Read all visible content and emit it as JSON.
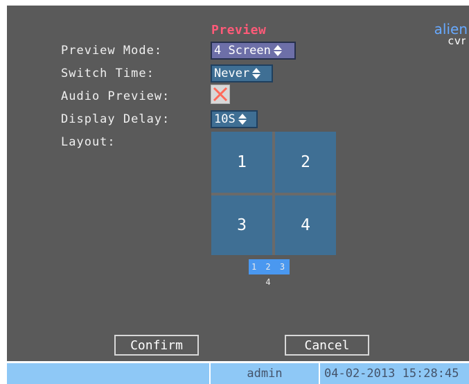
{
  "page": {
    "title": "Preview"
  },
  "logo": {
    "line1": "alien",
    "line2": "cvr"
  },
  "settings": {
    "preview_mode": {
      "label": "Preview Mode:",
      "value": "4 Screen"
    },
    "switch_time": {
      "label": "Switch Time:",
      "value": "Never"
    },
    "audio_preview": {
      "label": "Audio Preview:",
      "checked": false
    },
    "display_delay": {
      "label": "Display Delay:",
      "value": "10S"
    },
    "layout": {
      "label": "Layout:",
      "cells": [
        "1",
        "2",
        "3",
        "4"
      ],
      "page_selector": "1 2 3 4"
    }
  },
  "buttons": {
    "confirm": "Confirm",
    "cancel": "Cancel"
  },
  "status_bar": {
    "user": "admin",
    "datetime": "04-02-2013 15:28:45"
  },
  "colors": {
    "panel": "#5a5a5a",
    "title": "#ff5a78",
    "cell": "#3f6f94",
    "status": "#8ec8f6",
    "logo": "#67a9ff"
  }
}
